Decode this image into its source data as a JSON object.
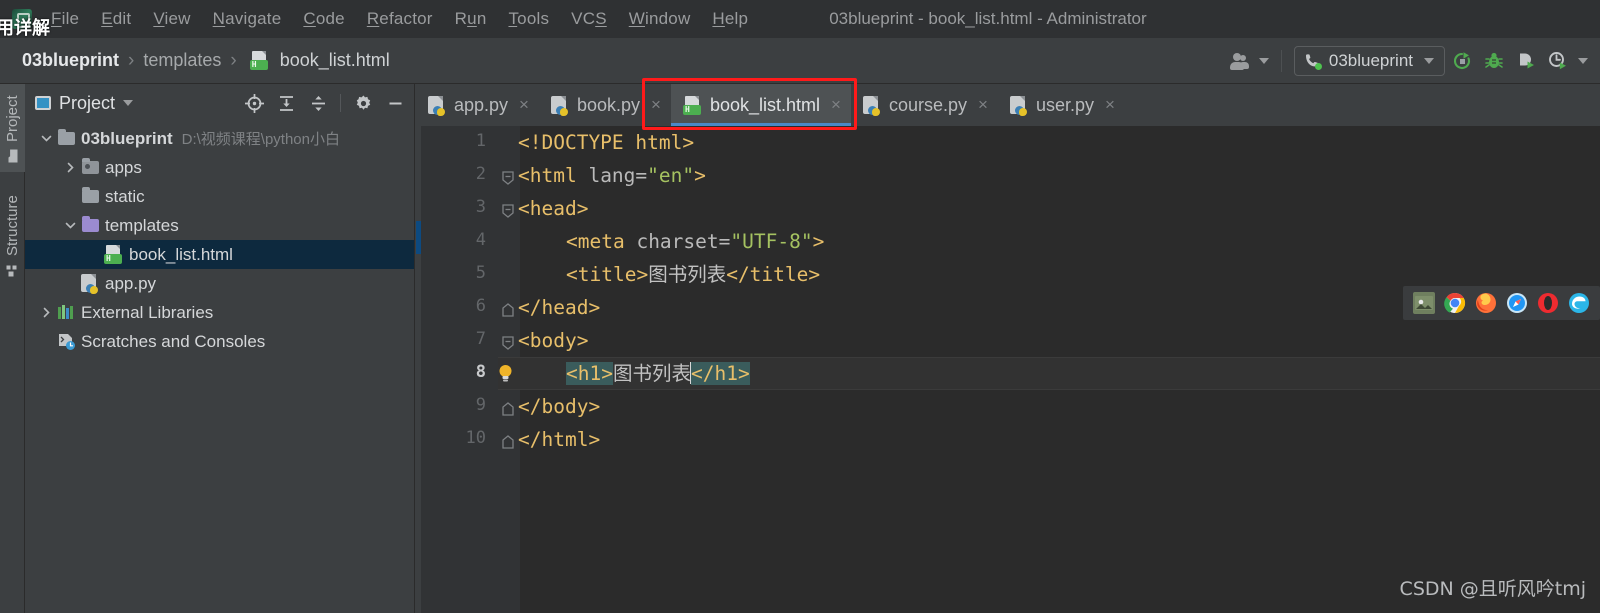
{
  "window": {
    "title": "03blueprint - book_list.html - Administrator",
    "corner_overlay_text": "用详解"
  },
  "menubar": {
    "items": [
      {
        "label": "File",
        "mnemonic": "F"
      },
      {
        "label": "Edit",
        "mnemonic": "E"
      },
      {
        "label": "View",
        "mnemonic": "V"
      },
      {
        "label": "Navigate",
        "mnemonic": "N"
      },
      {
        "label": "Code",
        "mnemonic": "C"
      },
      {
        "label": "Refactor",
        "mnemonic": "R"
      },
      {
        "label": "Run",
        "mnemonic": "u"
      },
      {
        "label": "Tools",
        "mnemonic": "T"
      },
      {
        "label": "VCS",
        "mnemonic": "S"
      },
      {
        "label": "Window",
        "mnemonic": "W"
      },
      {
        "label": "Help",
        "mnemonic": "H"
      }
    ]
  },
  "breadcrumb": {
    "items": [
      "03blueprint",
      "templates",
      "book_list.html"
    ],
    "separator": "›"
  },
  "nav_toolbar": {
    "people_icon": "people-icon",
    "run_config": {
      "label": "03blueprint",
      "icon": "phone-icon",
      "caret": "chevron-down-icon"
    },
    "buttons": [
      {
        "name": "rerun-icon",
        "color": "#5a9e5a"
      },
      {
        "name": "debug-bug-icon",
        "color": "#5a9e5a"
      },
      {
        "name": "coverage-run-icon",
        "color": "#bfc2c4"
      },
      {
        "name": "profile-run-icon",
        "color": "#bfc2c4"
      },
      {
        "name": "chevron-down-icon",
        "color": "#9a9c9e"
      }
    ]
  },
  "tool_tabs": [
    {
      "label": "Project",
      "active": true
    },
    {
      "label": "Structure",
      "active": false
    }
  ],
  "project_panel": {
    "title": "Project",
    "caret": "chevron-down-icon",
    "tools": [
      "locate-target-icon",
      "expand-all-icon",
      "collapse-all-icon",
      "settings-gear-icon",
      "minimize-icon"
    ],
    "tree": [
      {
        "label": "03blueprint",
        "path": "D:\\视频课程\\python小白",
        "icon": "folder-icon",
        "depth": 0,
        "arrow": "expanded",
        "bold": true,
        "selected": false
      },
      {
        "label": "apps",
        "path": "",
        "icon": "source-folder-icon",
        "depth": 1,
        "arrow": "collapsed",
        "bold": false,
        "selected": false
      },
      {
        "label": "static",
        "path": "",
        "icon": "folder-icon",
        "depth": 1,
        "arrow": "none",
        "bold": false,
        "selected": false
      },
      {
        "label": "templates",
        "path": "",
        "icon": "templates-folder-icon",
        "depth": 1,
        "arrow": "expanded",
        "bold": false,
        "selected": false
      },
      {
        "label": "book_list.html",
        "path": "",
        "icon": "html-file-icon",
        "depth": 2,
        "arrow": "none",
        "bold": false,
        "selected": true
      },
      {
        "label": "app.py",
        "path": "",
        "icon": "python-file-icon",
        "depth": 1,
        "arrow": "none",
        "bold": false,
        "selected": false
      },
      {
        "label": "External Libraries",
        "path": "",
        "icon": "libraries-icon",
        "depth": 0,
        "arrow": "collapsed",
        "bold": false,
        "selected": false
      },
      {
        "label": "Scratches and Consoles",
        "path": "",
        "icon": "scratches-icon",
        "depth": 0,
        "arrow": "none",
        "bold": false,
        "selected": false
      }
    ]
  },
  "editor_tabs": [
    {
      "label": "app.py",
      "icon": "python-file-icon",
      "active": false,
      "close": "×"
    },
    {
      "label": "book.py",
      "icon": "python-file-icon",
      "active": false,
      "close": "×"
    },
    {
      "label": "book_list.html",
      "icon": "html-file-icon",
      "active": true,
      "close": "×",
      "annotated": true
    },
    {
      "label": "course.py",
      "icon": "python-file-icon",
      "active": false,
      "close": "×"
    },
    {
      "label": "user.py",
      "icon": "python-file-icon",
      "active": false,
      "close": "×"
    }
  ],
  "annotation": {
    "type": "red-rectangle",
    "color": "#ff1a1a",
    "target": "book_list.html tab"
  },
  "editor": {
    "current_line": 8,
    "line_numbers": [
      1,
      2,
      3,
      4,
      5,
      6,
      7,
      8,
      9,
      10
    ],
    "fold_markers": [
      {
        "line": 2,
        "type": "open"
      },
      {
        "line": 3,
        "type": "open"
      },
      {
        "line": 6,
        "type": "close"
      },
      {
        "line": 7,
        "type": "open"
      },
      {
        "line": 9,
        "type": "close"
      },
      {
        "line": 10,
        "type": "close"
      }
    ],
    "lightbulb_line": 8,
    "lines": [
      {
        "n": 1,
        "indent": 0,
        "segs": [
          {
            "t": "<!DOCTYPE html>",
            "c": "tag"
          }
        ]
      },
      {
        "n": 2,
        "indent": 0,
        "segs": [
          {
            "t": "<html ",
            "c": "tag"
          },
          {
            "t": "lang=",
            "c": "attr"
          },
          {
            "t": "\"en\"",
            "c": "val"
          },
          {
            "t": ">",
            "c": "tag"
          }
        ]
      },
      {
        "n": 3,
        "indent": 0,
        "segs": [
          {
            "t": "<head>",
            "c": "tag"
          }
        ]
      },
      {
        "n": 4,
        "indent": 1,
        "segs": [
          {
            "t": "<meta ",
            "c": "tag"
          },
          {
            "t": "charset=",
            "c": "attr"
          },
          {
            "t": "\"UTF-8\"",
            "c": "val"
          },
          {
            "t": ">",
            "c": "tag"
          }
        ]
      },
      {
        "n": 5,
        "indent": 1,
        "segs": [
          {
            "t": "<title>",
            "c": "tag"
          },
          {
            "t": "图书列表",
            "c": "txt"
          },
          {
            "t": "</title>",
            "c": "tag"
          }
        ]
      },
      {
        "n": 6,
        "indent": 0,
        "segs": [
          {
            "t": "</head>",
            "c": "tag"
          }
        ]
      },
      {
        "n": 7,
        "indent": 0,
        "segs": [
          {
            "t": "<body>",
            "c": "tag"
          }
        ]
      },
      {
        "n": 8,
        "indent": 1,
        "segs": [
          {
            "t": "<h1>",
            "c": "tagsel"
          },
          {
            "t": "图书列表",
            "c": "txt"
          },
          {
            "t": "CARET",
            "c": "caret"
          },
          {
            "t": "</h1>",
            "c": "tagsel"
          }
        ]
      },
      {
        "n": 9,
        "indent": 0,
        "segs": [
          {
            "t": "</body>",
            "c": "tag"
          }
        ]
      },
      {
        "n": 10,
        "indent": 0,
        "segs": [
          {
            "t": "</html>",
            "c": "tag"
          }
        ]
      }
    ],
    "colors": {
      "background": "#2b2b2b",
      "gutter": "#313335",
      "tag": "#e8bf6a",
      "attribute": "#bababa",
      "attr_value": "#a5c261",
      "text": "#c2c2c2",
      "tag_pair_highlight": "#3a5c5c",
      "current_line": "#323232",
      "selected_tab_underline": "#4a88c7"
    }
  },
  "browser_strip": {
    "items": [
      {
        "name": "preview-icon",
        "color": "#7a8a6a"
      },
      {
        "name": "chrome-icon",
        "color": "#4285f4"
      },
      {
        "name": "firefox-icon",
        "color": "#ff7139"
      },
      {
        "name": "safari-icon",
        "color": "#2196f3"
      },
      {
        "name": "opera-icon",
        "color": "#ee2b30"
      },
      {
        "name": "edge-icon",
        "color": "#2bb6e8"
      }
    ]
  },
  "watermark": {
    "text": "CSDN @且听风吟tmj"
  }
}
